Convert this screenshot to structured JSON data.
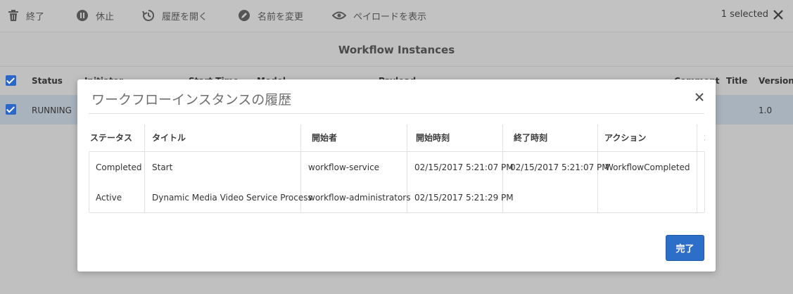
{
  "toolbar": {
    "items": [
      {
        "label": "終了",
        "icon": "trash-icon"
      },
      {
        "label": "休止",
        "icon": "pause-icon"
      },
      {
        "label": "履歴を開く",
        "icon": "history-icon"
      },
      {
        "label": "名前を変更",
        "icon": "pencil-icon"
      },
      {
        "label": "ペイロードを表示",
        "icon": "eye-icon"
      }
    ],
    "selected_label": "1 selected"
  },
  "page_title": "Workflow Instances",
  "table": {
    "headers": [
      "Status",
      "Initiator",
      "Start Time",
      "Model",
      "Payload",
      "Comment",
      "Title",
      "Version"
    ],
    "row": {
      "status": "RUNNING",
      "version": "1.0"
    }
  },
  "modal": {
    "title": "ワークフローインスタンスの履歴",
    "headers": [
      "ステータス",
      "タイトル",
      "開始者",
      "開始時刻",
      "終了時刻",
      "アクション",
      "コ"
    ],
    "rows": [
      {
        "status": "Completed",
        "title": "Start",
        "user": "workflow-service",
        "start": "02/15/2017 5:21:07 PM",
        "end": "02/15/2017 5:21:07 PM",
        "action": "WorkflowCompleted"
      },
      {
        "status": "Active",
        "title": "Dynamic Media Video Service Process",
        "user": "workflow-administrators",
        "start": "02/15/2017 5:21:29 PM",
        "end": "",
        "action": ""
      }
    ],
    "done_label": "完了"
  }
}
